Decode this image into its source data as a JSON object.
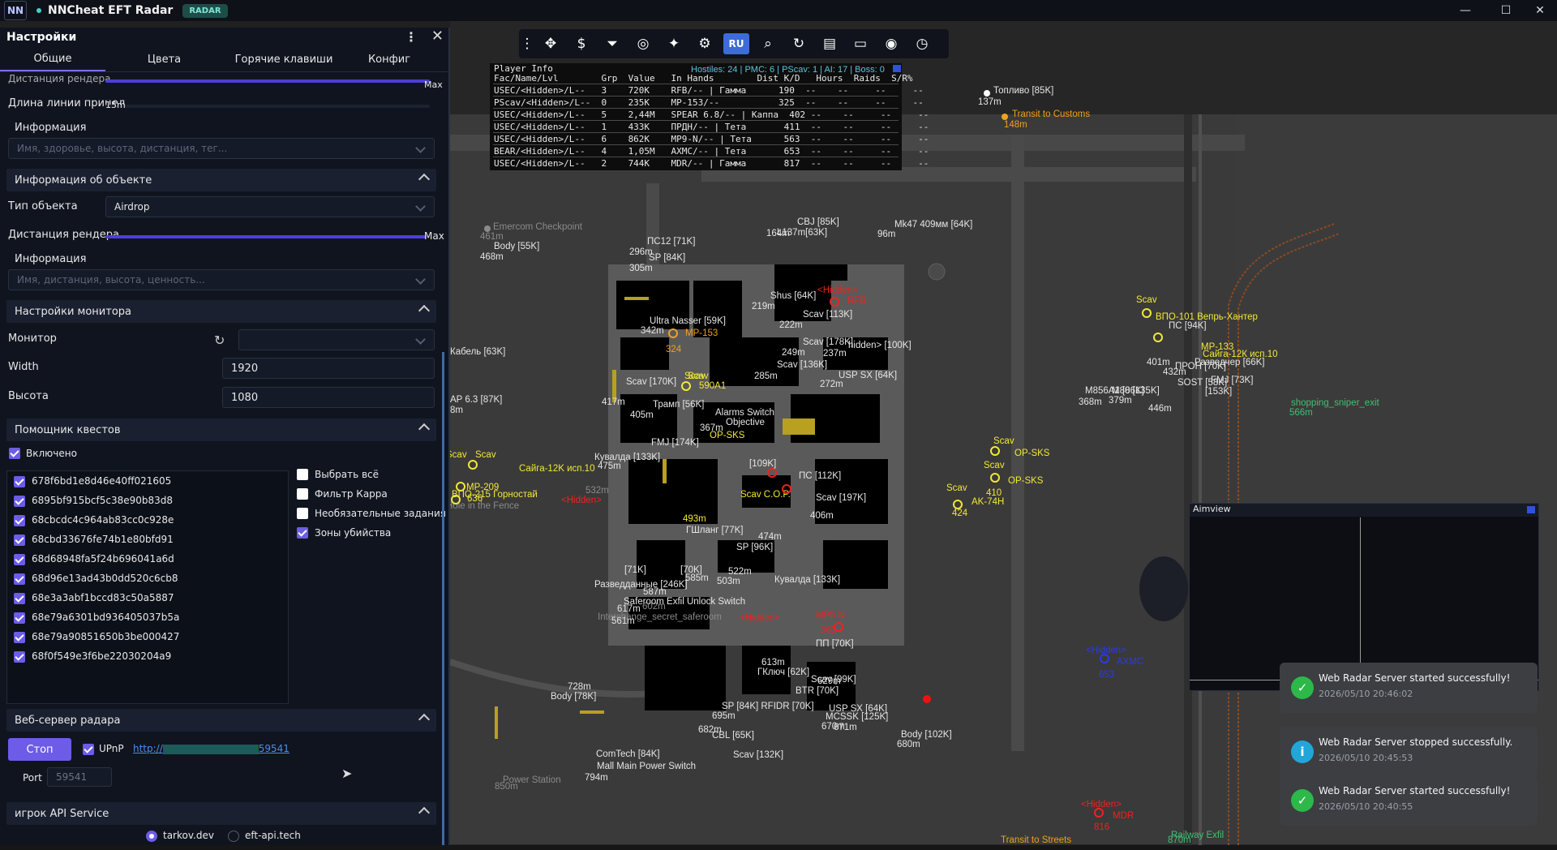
{
  "app": {
    "logo": "NN",
    "title": "NNCheat EFT Radar",
    "badge": "RADAR"
  },
  "window": {
    "minimize": "—",
    "maximize": "☐",
    "close": "✕"
  },
  "panel": {
    "title": "Настройки",
    "tabs": [
      "Общие",
      "Цвета",
      "Горячие клавиши",
      "Конфиг"
    ],
    "render_distance_label": "Дистанция рендера",
    "render_distance_max": "Max",
    "line_length_label": "Длина линии прицел",
    "line_length_value": "15m",
    "info_label": "Информация",
    "info_placeholder": "Имя, здоровье, высота, дистанция, тег...",
    "object_section": "Информация об объекте",
    "object_type_label": "Тип объекта",
    "object_type_value": "Airdrop",
    "object_render_label": "Дистанция рендера",
    "object_render_max": "Max",
    "object_info_label": "Информация",
    "object_info_placeholder": "Имя, дистанция, высота, ценность...",
    "monitor_section": "Настройки монитора",
    "monitor_label": "Монитор",
    "width_label": "Width",
    "width_value": "1920",
    "height_label": "Высота",
    "height_value": "1080",
    "quest_section": "Помощник квестов",
    "enabled_label": "Включено",
    "quests": [
      "678f6bd1e8d46e40ff021605",
      "6895bf915bcf5c38e90b83d8",
      "68cbcdc4c964ab83cc0c928e",
      "68cbd33676fe74b1e80bfd91",
      "68d68948fa5f24b696041a6d",
      "68d96e13ad43b0dd520c6cb8",
      "68e3a3abf1bccd83c50a5887",
      "68e79a6301bd936405037b5a",
      "68e79a90851650b3be000427",
      "68f0f549e3f6be22030204a9"
    ],
    "quest_options": [
      {
        "label": "Выбрать всё",
        "checked": false
      },
      {
        "label": "Фильтр Карра",
        "checked": false
      },
      {
        "label": "Необязательные задания",
        "checked": false
      },
      {
        "label": "Зоны убийства",
        "checked": true
      }
    ],
    "webserver_section": "Веб-сервер радара",
    "stop_button": "Стоп",
    "upnp_label": "UPnP",
    "url_prefix": "http://",
    "url_suffix": "59541",
    "port_label": "Port",
    "port_value": "59541",
    "api_section": "игрок API Service",
    "api_options": [
      {
        "label": "tarkov.dev",
        "selected": true
      },
      {
        "label": "eft-api.tech",
        "selected": false
      }
    ]
  },
  "toolbar": {
    "lang": "RU"
  },
  "player_info": {
    "title": "Player Info",
    "hostiles": "Hostiles: 24 | PMC: 6 | PScav: 1 | AI: 17 | Boss: 0",
    "header": "Fac/Name/Lvl        Grp  Value   In Hands        Dist K/D   Hours  Raids  S/R%",
    "rows": [
      "USEC/<Hidden>/L--   3    720K    RFB/-- | Гамма      190  --    --     --     --",
      "PScav/<Hidden>/L--  0    235K    MP-153/--           325  --    --     --     --",
      "USEC/<Hidden>/L--   5    2,44M   SPEAR 6.8/-- | Каппа  402 --    --     --     --",
      "USEC/<Hidden>/L--   1    433K    ПРДН/-- | Тета       411  --    --     --     --",
      "USEC/<Hidden>/L--   6    862K    MP9-N/-- | Тета      563  --    --     --     --",
      "BEAR/<Hidden>/L--   4    1,05M   AXMC/-- | Тета       653  --    --     --     --",
      "USEC/<Hidden>/L--   2    744K    MDR/-- | Гамма       817  --    --     --     --"
    ]
  },
  "map_labels": [
    {
      "t": "Топливо [85K]",
      "c": "white"
    },
    {
      "t": "137m",
      "c": "white"
    },
    {
      "t": "Transit to Customs",
      "c": "ora"
    },
    {
      "t": "148m",
      "c": "ora"
    },
    {
      "t": "Emercom Checkpoint",
      "c": "gray"
    },
    {
      "t": "461m",
      "c": "gray"
    },
    {
      "t": "Body [55K]",
      "c": "white"
    },
    {
      "t": "468m",
      "c": "white"
    },
    {
      "t": "ПС12 [71K]",
      "c": "white"
    },
    {
      "t": "296m",
      "c": "white"
    },
    {
      "t": "SP [84K]",
      "c": "white"
    },
    {
      "t": "305m",
      "c": "white"
    },
    {
      "t": "CBJ [85K]",
      "c": "white"
    },
    {
      "t": "L137m[63K]",
      "c": "white"
    },
    {
      "t": "164m",
      "c": "white"
    },
    {
      "t": "Mk47 409мм [64K]",
      "c": "white"
    },
    {
      "t": "96m",
      "c": "white"
    },
    {
      "t": "Shus [64K]",
      "c": "white"
    },
    {
      "t": "219m",
      "c": "white"
    },
    {
      "t": "<Hidden>",
      "c": "red"
    },
    {
      "t": "RFB",
      "c": "red"
    },
    {
      "t": "Scav [113K]",
      "c": "white"
    },
    {
      "t": "222m",
      "c": "white"
    },
    {
      "t": "Scav [178K]",
      "c": "white"
    },
    {
      "t": "249m",
      "c": "white"
    },
    {
      "t": "237m",
      "c": "white"
    },
    {
      "t": "hidden> [100K]",
      "c": "white"
    },
    {
      "t": "Scav [136K]",
      "c": "white"
    },
    {
      "t": "285m",
      "c": "white"
    },
    {
      "t": "USP SX [64K]",
      "c": "white"
    },
    {
      "t": "272m",
      "c": "white"
    },
    {
      "t": "Ultra Nasser [59K]",
      "c": "white"
    },
    {
      "t": "342m",
      "c": "white"
    },
    {
      "t": "MP-153",
      "c": "ora"
    },
    {
      "t": "324",
      "c": "ora"
    },
    {
      "t": "Кабель [63K]",
      "c": "white"
    },
    {
      "t": "Scav",
      "c": "yel"
    },
    {
      "t": "590A1",
      "c": "yel"
    },
    {
      "t": "Scav [170K]",
      "c": "white"
    },
    {
      "t": "417m",
      "c": "white"
    },
    {
      "t": "Трамп [56K]",
      "c": "white"
    },
    {
      "t": "405m",
      "c": "white"
    },
    {
      "t": "AP 6.3 [87K]",
      "c": "white"
    },
    {
      "t": "8m",
      "c": "white"
    },
    {
      "t": "Alarms Switch",
      "c": "white"
    },
    {
      "t": "Objective",
      "c": "white"
    },
    {
      "t": "367m",
      "c": "white"
    },
    {
      "t": "FMJ [174K]",
      "c": "white"
    },
    {
      "t": "475m",
      "c": "white"
    },
    {
      "t": "Кувалда [133K]",
      "c": "white"
    },
    {
      "t": "Scav",
      "c": "yel"
    },
    {
      "t": "OP-SKS",
      "c": "yel"
    },
    {
      "t": "Scav",
      "c": "yel"
    },
    {
      "t": "Сайга-12K исп.10",
      "c": "yel"
    },
    {
      "t": "Scav",
      "c": "yel"
    },
    {
      "t": "MP-209",
      "c": "yel"
    },
    {
      "t": "ВПО-215 Горностай",
      "c": "yel"
    },
    {
      "t": "636",
      "c": "yel"
    },
    {
      "t": "Hole in the Fence",
      "c": "gray"
    },
    {
      "t": "532m",
      "c": "gray"
    },
    {
      "t": "<Hidden>",
      "c": "red"
    },
    {
      "t": "[109K]",
      "c": "white"
    },
    {
      "t": "ПС [112K]",
      "c": "white"
    },
    {
      "t": "Scav [197K]",
      "c": "white"
    },
    {
      "t": "406m",
      "c": "white"
    },
    {
      "t": "Scav C.O.P.",
      "c": "yel"
    },
    {
      "t": "493m",
      "c": "yel"
    },
    {
      "t": "ГШланг [77K]",
      "c": "white"
    },
    {
      "t": "474m",
      "c": "white"
    },
    {
      "t": "SP [96K]",
      "c": "white"
    },
    {
      "t": "[71K]",
      "c": "white"
    },
    {
      "t": "[70K]",
      "c": "white"
    },
    {
      "t": "585m",
      "c": "white"
    },
    {
      "t": "Разведданные [246K]",
      "c": "white"
    },
    {
      "t": "587m",
      "c": "white"
    },
    {
      "t": "Saferoom Exfil Unlock Switch",
      "c": "white"
    },
    {
      "t": "522m",
      "c": "white"
    },
    {
      "t": "503m",
      "c": "white"
    },
    {
      "t": "Кувалда [133K]",
      "c": "white"
    },
    {
      "t": "617m",
      "c": "white"
    },
    {
      "t": "Interchange_secret_saferoom",
      "c": "gray"
    },
    {
      "t": "602m",
      "c": "gray"
    },
    {
      "t": "561m",
      "c": "white"
    },
    {
      "t": "<Hidden>",
      "c": "red"
    },
    {
      "t": "MP9-N",
      "c": "red"
    },
    {
      "t": "563",
      "c": "red"
    },
    {
      "t": "ПП [70K]",
      "c": "white"
    },
    {
      "t": "613m",
      "c": "white"
    },
    {
      "t": "ГКлюч [62K]",
      "c": "white"
    },
    {
      "t": "728m",
      "c": "white"
    },
    {
      "t": "Body [78K]",
      "c": "white"
    },
    {
      "t": "Scav [99K]",
      "c": "white"
    },
    {
      "t": "629m",
      "c": "white"
    },
    {
      "t": "BTR [70K]",
      "c": "white"
    },
    {
      "t": "SP [84K] RFIDR [70K]",
      "c": "white"
    },
    {
      "t": "695m",
      "c": "white"
    },
    {
      "t": "682m",
      "c": "white"
    },
    {
      "t": "CBL [65K]",
      "c": "white"
    },
    {
      "t": "USP SX [64K]",
      "c": "white"
    },
    {
      "t": "MCSSK [125K]",
      "c": "white"
    },
    {
      "t": "670m",
      "c": "white"
    },
    {
      "t": "671m",
      "c": "white"
    },
    {
      "t": "Body [102K]",
      "c": "white"
    },
    {
      "t": "680m",
      "c": "white"
    },
    {
      "t": "ComTech [84K]",
      "c": "white"
    },
    {
      "t": "Mall Main Power Switch",
      "c": "white"
    },
    {
      "t": "794m",
      "c": "white"
    },
    {
      "t": "Scav [132K]",
      "c": "white"
    },
    {
      "t": "Power Station",
      "c": "gray"
    },
    {
      "t": "850m",
      "c": "gray"
    },
    {
      "t": "Scav",
      "c": "yel"
    },
    {
      "t": "ВПО-101 Вепрь-Хантер",
      "c": "yel"
    },
    {
      "t": "ПС [94K]",
      "c": "white"
    },
    {
      "t": "MP-133",
      "c": "yel"
    },
    {
      "t": "Сайга-12К исп.10",
      "c": "yel"
    },
    {
      "t": "401m",
      "c": "white"
    },
    {
      "t": "ПРОН [70K]",
      "c": "white"
    },
    {
      "t": "432m",
      "c": "white"
    },
    {
      "t": "Разведчер [66K]",
      "c": "white"
    },
    {
      "t": "M856A1 [86K]",
      "c": "white"
    },
    {
      "t": "368m",
      "c": "white"
    },
    {
      "t": "M80 [135K]",
      "c": "white"
    },
    {
      "t": "379m",
      "c": "white"
    },
    {
      "t": "SOST [58K]",
      "c": "white"
    },
    {
      "t": "FMJ [73K]",
      "c": "white"
    },
    {
      "t": "[153K]",
      "c": "white"
    },
    {
      "t": "446m",
      "c": "white"
    },
    {
      "t": "shopping_sniper_exit",
      "c": "green"
    },
    {
      "t": "566m",
      "c": "green"
    },
    {
      "t": "Scav",
      "c": "yel"
    },
    {
      "t": "OP-SKS",
      "c": "yel"
    },
    {
      "t": "Scav",
      "c": "yel"
    },
    {
      "t": "OP-SKS",
      "c": "yel"
    },
    {
      "t": "410",
      "c": "yel"
    },
    {
      "t": "Scav",
      "c": "yel"
    },
    {
      "t": "AK-74H",
      "c": "yel"
    },
    {
      "t": "424",
      "c": "yel"
    },
    {
      "t": "<Hidden>",
      "c": "blue"
    },
    {
      "t": "AXMC",
      "c": "blue"
    },
    {
      "t": "653",
      "c": "blue"
    },
    {
      "t": "<Hidden>",
      "c": "red"
    },
    {
      "t": "MDR",
      "c": "red"
    },
    {
      "t": "816",
      "c": "red"
    },
    {
      "t": "Transit to Streets",
      "c": "ora"
    },
    {
      "t": "Railway Exfil",
      "c": "green"
    },
    {
      "t": "870m",
      "c": "green"
    }
  ],
  "aimview": {
    "title": "Aimview"
  },
  "toasts": [
    {
      "title": "Web Radar Server started successfully!",
      "time": "2026/05/10 20:46:02",
      "kind": "success"
    },
    {
      "title": "Web Radar Server stopped successfully.",
      "time": "2026/05/10 20:45:53",
      "kind": "info"
    },
    {
      "title": "Web Radar Server started successfully!",
      "time": "2026/05/10 20:40:55",
      "kind": "success"
    }
  ],
  "colors": {
    "accent": "#6c5ce7",
    "enemy_red": "#ee2222",
    "scav_yellow": "#f2e836",
    "friendly_blue": "#2a3ae8",
    "exfil_green": "#3ec074",
    "success_green": "#2db84a",
    "info_cyan": "#22a6d8"
  }
}
